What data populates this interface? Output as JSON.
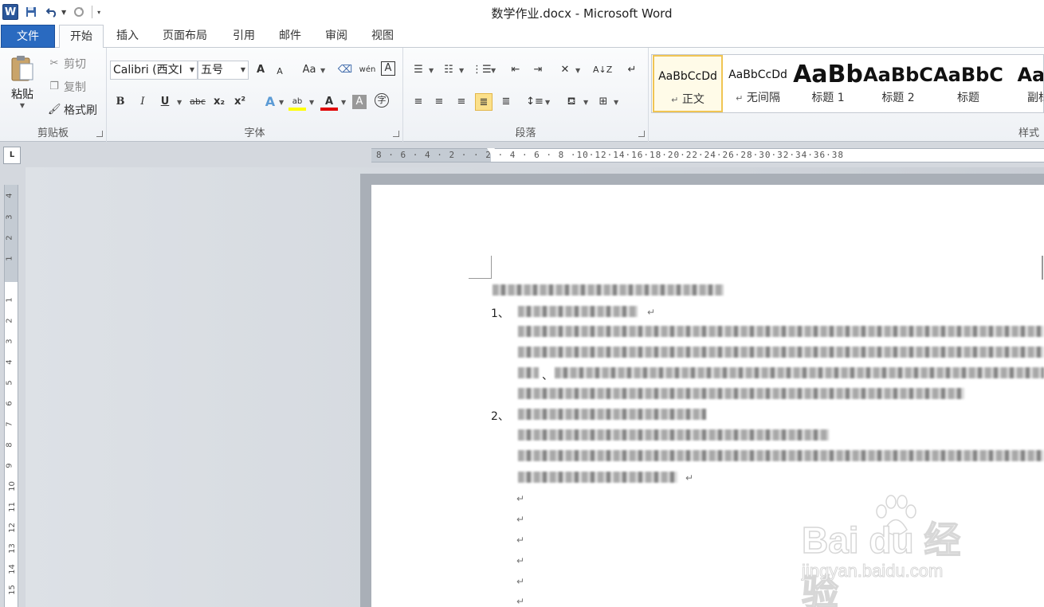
{
  "window": {
    "title": "数学作业.docx - Microsoft Word",
    "app_icon": "W"
  },
  "qat": {
    "save_icon": "save-icon",
    "undo_icon": "undo-icon",
    "redo_icon": "redo-icon"
  },
  "tabs": [
    {
      "label": "文件"
    },
    {
      "label": "开始"
    },
    {
      "label": "插入"
    },
    {
      "label": "页面布局"
    },
    {
      "label": "引用"
    },
    {
      "label": "邮件"
    },
    {
      "label": "审阅"
    },
    {
      "label": "视图"
    }
  ],
  "clipboard": {
    "paste": "粘贴",
    "cut": "剪切",
    "copy": "复制",
    "format_painter": "格式刷",
    "label": "剪贴板"
  },
  "font": {
    "name": "Calibri (西文I",
    "size": "五号",
    "label": "字体",
    "grow": "A",
    "shrink": "A",
    "case": "Aa",
    "bold": "B",
    "italic": "I",
    "underline": "U",
    "strike": "abc",
    "sub": "x₂",
    "sup": "x²",
    "effects": "A",
    "highlight": "ab",
    "color": "A",
    "shade": "A",
    "enclose": "字",
    "phonetic": "wén",
    "border_char": "A"
  },
  "paragraph": {
    "label": "段落"
  },
  "styles": {
    "label": "样式",
    "items": [
      {
        "preview": "AaBbCcDd",
        "name": "正文",
        "mark": "↵"
      },
      {
        "preview": "AaBbCcDd",
        "name": "无间隔",
        "mark": "↵"
      },
      {
        "preview": "AaBb",
        "name": "标题 1"
      },
      {
        "preview": "AaBbC",
        "name": "标题 2"
      },
      {
        "preview": "AaBbC",
        "name": "标题"
      },
      {
        "preview": "AaB",
        "name": "副标"
      }
    ]
  },
  "ruler": {
    "corner": "L",
    "h_nums": "8 · 6 · 4 · 2 ·  · 2 · 4 · 6 · 8 ·10·12·14·16·18·20·22·24·26·28·30·32·34·36·38",
    "v_nums": [
      "4",
      "3",
      "2",
      "1",
      "",
      "1",
      "2",
      "3",
      "4",
      "5",
      "6",
      "7",
      "8",
      "9",
      "10",
      "11",
      "12",
      "13",
      "14",
      "15"
    ]
  },
  "document": {
    "list_item_1": "1、",
    "list_item_2": "2、",
    "fragment_1": "、",
    "para_mark": "↵"
  },
  "watermark": {
    "brand": "Bai du 经验",
    "url": "jingyan.baidu.com"
  }
}
